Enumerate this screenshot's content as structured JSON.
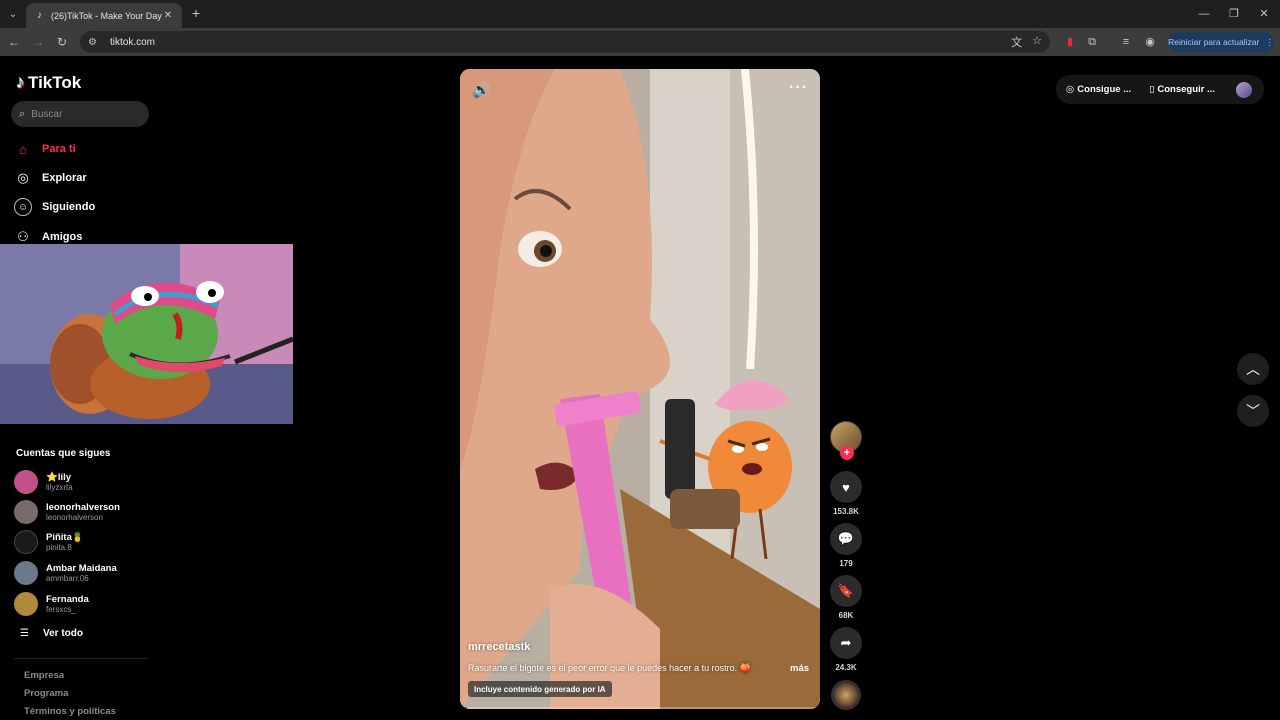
{
  "browser": {
    "tab_title": "(26)TikTok - Make Your Day",
    "url": "tiktok.com",
    "update_button": "Reiniciar para actualizar"
  },
  "sidebar": {
    "brand": "TikTok",
    "search_placeholder": "Buscar",
    "nav": [
      {
        "label": "Para ti",
        "icon": "home-icon",
        "active": true
      },
      {
        "label": "Explorar",
        "icon": "compass-icon"
      },
      {
        "label": "Siguiendo",
        "icon": "following-icon"
      },
      {
        "label": "Amigos",
        "icon": "friends-icon"
      }
    ],
    "following_heading": "Cuentas que sigues",
    "accounts": [
      {
        "name": "⭐lily",
        "handle": "lilyzxrta",
        "color": "#c0508a"
      },
      {
        "name": "leonorhalverson",
        "handle": "leonorhalverson",
        "color": "#7a6a6a"
      },
      {
        "name": "Piñita🍍",
        "handle": "pinita.8",
        "color": "#1a1a1a"
      },
      {
        "name": "Ambar Maidana",
        "handle": "ammbarr.06",
        "color": "#6a7a8a"
      },
      {
        "name": "Fernanda",
        "handle": "fersxcs_",
        "color": "#b08a3a"
      }
    ],
    "see_all": "Ver todo",
    "footer": [
      "Empresa",
      "Programa",
      "Términos y políticas"
    ]
  },
  "video": {
    "author": "mrrecetastk",
    "description": "Rasurarte el bigote es el peor error que le puedes hacer a tu rostro. 🍑",
    "more": "más",
    "ai_label": "Incluye contenido generado por IA",
    "progress": 0.02
  },
  "actions": {
    "likes": "153.8K",
    "comments": "179",
    "saves": "68K",
    "shares": "24.3K"
  },
  "top_right": {
    "coins": "Consigue ...",
    "app": "Conseguir ..."
  },
  "colors": {
    "accent": "#fe2c55",
    "background": "#000000"
  }
}
